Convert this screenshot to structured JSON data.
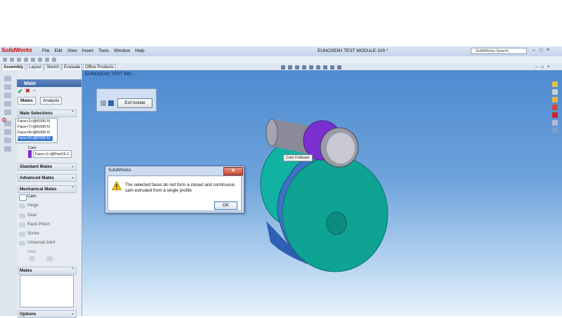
{
  "app": {
    "logo": "SolidWorks",
    "title": "EUNOSEIKI TEST MODULE-100 *",
    "search_placeholder": "SolidWorks Search",
    "window_controls": [
      "–",
      "□",
      "×"
    ]
  },
  "menu": [
    "File",
    "Edit",
    "View",
    "Insert",
    "Tools",
    "Window",
    "Help"
  ],
  "command_tabs": [
    "Assembly",
    "Layout",
    "Sketch",
    "Evaluate",
    "Office Products"
  ],
  "property_manager": {
    "title": "Mate",
    "tabs": [
      "Mates",
      "Analysis"
    ],
    "mate_selections": {
      "header": "Mate Selections",
      "faces": [
        "Face<2>@K006-N",
        "Face<7>@K006-N",
        "Face<8>@K006-N",
        "Face<9>@K006-N"
      ],
      "cam_label": "Cam",
      "cam_value": "Face<1>@Part15-1"
    },
    "standard_mates": "Standard Mates",
    "advanced_mates": "Advanced Mates",
    "mechanical_mates": {
      "header": "Mechanical Mates",
      "items": [
        "Cam",
        "Hinge",
        "Gear",
        "Rack Pinion",
        "Screw",
        "Universal Joint"
      ],
      "sub_label": "Mate"
    },
    "mates_section": "Mates",
    "options_section": "Options"
  },
  "graphics": {
    "tree_item": "EUNOSEIKI TEST MO...",
    "cam_follower_tip": "Cam Follower"
  },
  "isolate": {
    "button": "Exit Isolate"
  },
  "dialog": {
    "title": "SolidWorks",
    "close": "✕",
    "message": "The selected faces do not form a closed and continuous cam extruded from a single profile",
    "ok": "OK"
  },
  "colors": {
    "teal": "#0f9c8f",
    "blue_part": "#3b68c0",
    "purple": "#7a2fd0",
    "gray_shaft": "#8a8a98"
  }
}
